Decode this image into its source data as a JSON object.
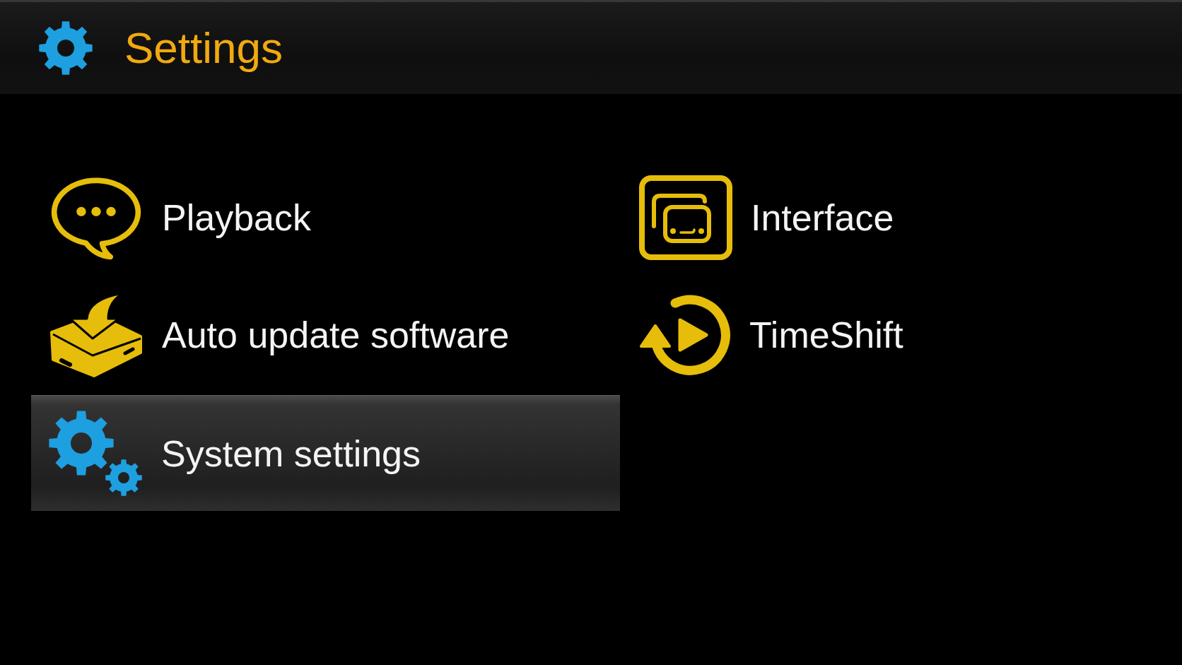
{
  "header": {
    "title": "Settings"
  },
  "items": [
    {
      "label": "Playback",
      "kind": "speech",
      "selected": false
    },
    {
      "label": "Interface",
      "kind": "window",
      "selected": false
    },
    {
      "label": "Auto update software",
      "kind": "download",
      "selected": false
    },
    {
      "label": "TimeShift",
      "kind": "replay",
      "selected": false
    },
    {
      "label": "System settings",
      "kind": "gears",
      "selected": true
    }
  ]
}
